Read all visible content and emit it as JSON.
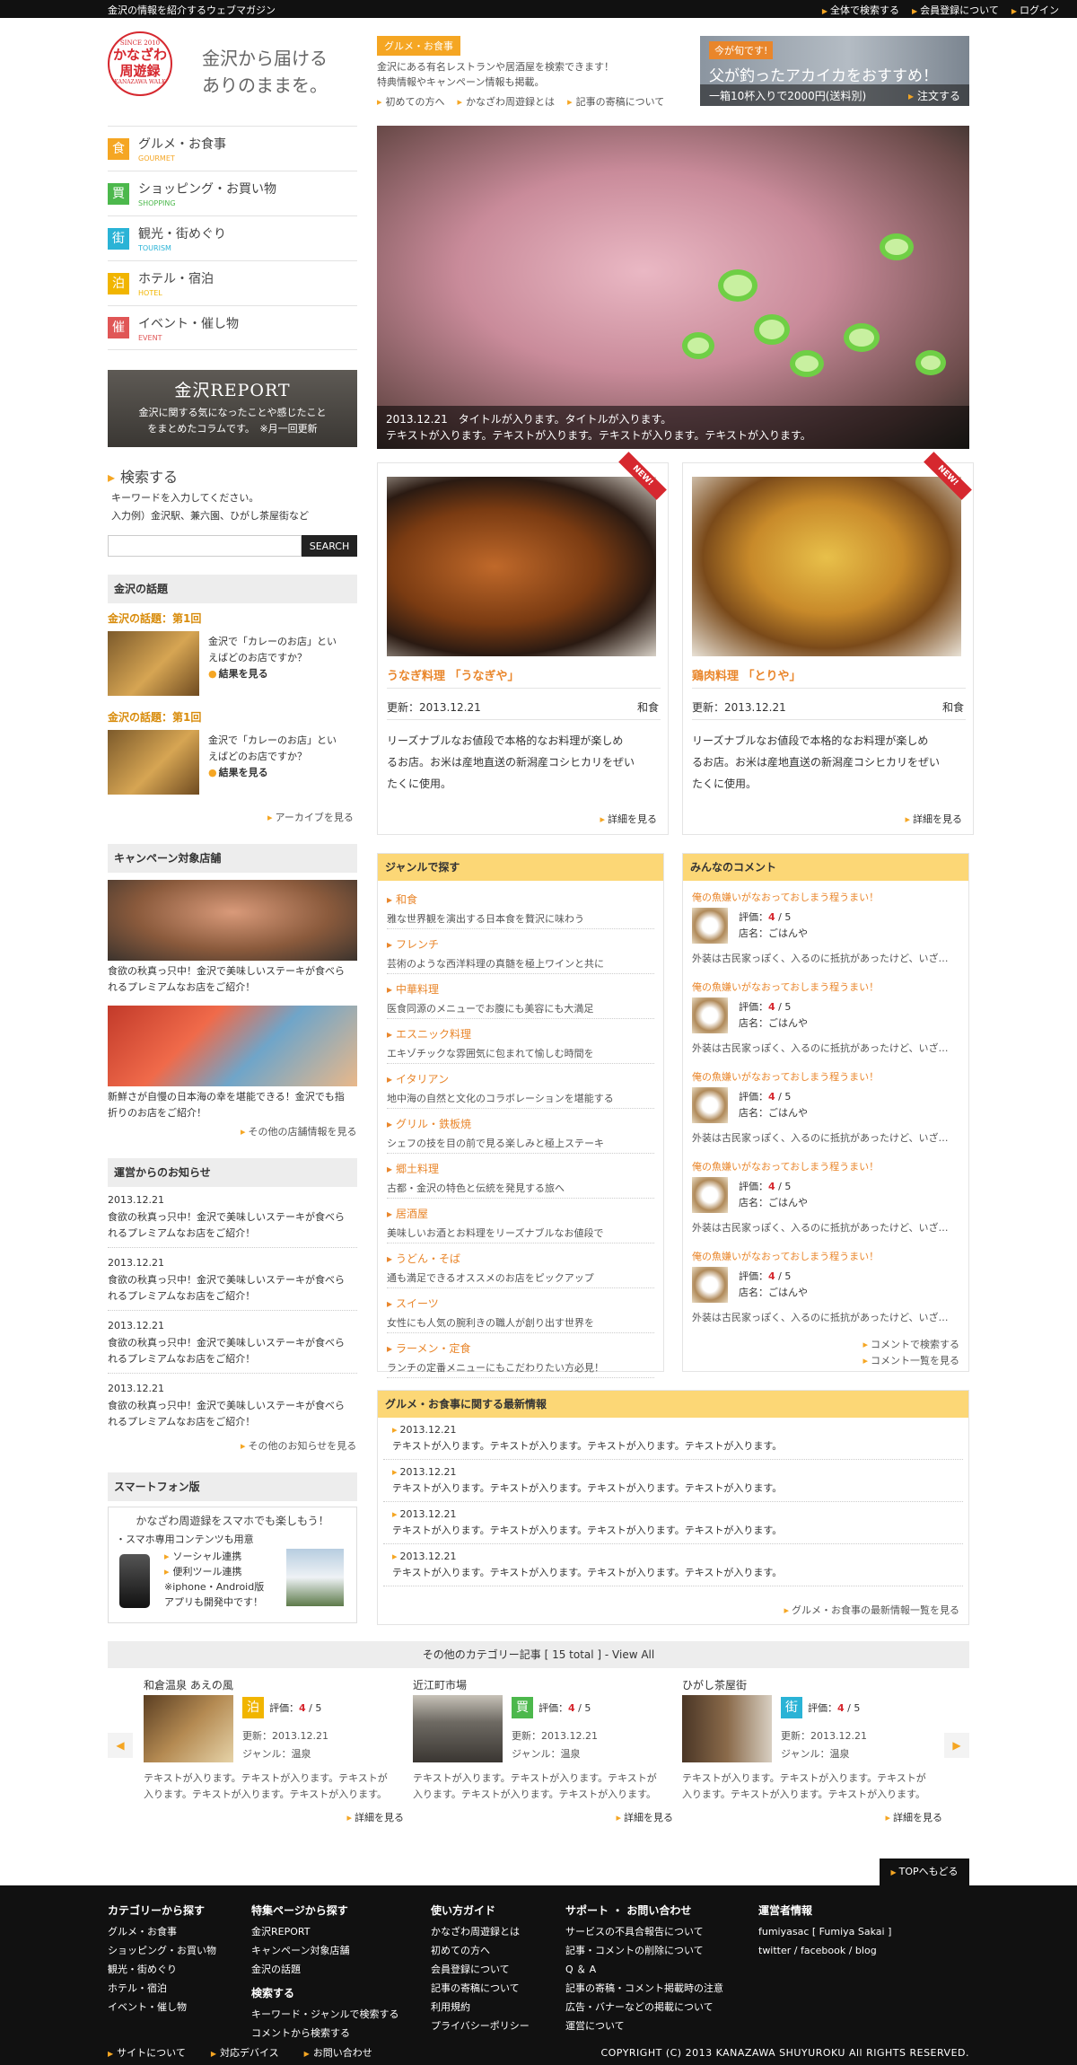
{
  "topbar": {
    "tagline": "金沢の情報を紹介するウェブマガジン",
    "links": [
      "全体で検索する",
      "会員登録について",
      "ログイン"
    ]
  },
  "logo": {
    "since": "SINCE 2010",
    "line1": "かなざわ",
    "line2": "周遊録",
    "sub": "KANAZAWA WALK"
  },
  "catchcopy": [
    "金沢から届ける",
    "ありのままを。"
  ],
  "header": {
    "category": "グルメ・お食事",
    "intro": [
      "金沢にある有名レストランや居酒屋を検索できます！",
      "特典情報やキャンペーン情報も掲載。"
    ],
    "links": [
      "初めての方へ",
      "かなざわ周遊録とは",
      "記事の寄稿について"
    ]
  },
  "promo": {
    "badge": "今が旬です!",
    "title": "父が釣ったアカイカをおすすめ！",
    "sub": "一箱10杯入りで2000円(送料別)",
    "action": "注文する"
  },
  "nav": [
    {
      "icon": "食",
      "label": "グルメ・お食事",
      "en": "GOURMET",
      "color": "#f5a623"
    },
    {
      "icon": "買",
      "label": "ショッピング・お買い物",
      "en": "SHOPPING",
      "color": "#4cb84c"
    },
    {
      "icon": "街",
      "label": "観光・街めぐり",
      "en": "TOURISM",
      "color": "#2ab3d6"
    },
    {
      "icon": "泊",
      "label": "ホテル・宿泊",
      "en": "HOTEL",
      "color": "#f1b500"
    },
    {
      "icon": "催",
      "label": "イベント・催し物",
      "en": "EVENT",
      "color": "#e05656"
    }
  ],
  "report": {
    "title": "金沢REPORT",
    "desc1": "金沢に関する気になったことや感じたこと",
    "desc2": "をまとめたコラムです。",
    "note": "※月一回更新"
  },
  "search": {
    "title": "検索する",
    "hint": "キーワードを入力してください。",
    "example": "入力例）金沢駅、兼六園、ひがし茶屋街など",
    "placeholder": "",
    "button": "SEARCH"
  },
  "topics": {
    "title": "金沢の話題",
    "items": [
      {
        "rank": "金沢の話題：第1回",
        "q1": "金沢で「カレーのお店」とい",
        "q2": "えばどのお店ですか？",
        "result": "結果を見る"
      },
      {
        "rank": "金沢の話題：第1回",
        "q1": "金沢で「カレーのお店」とい",
        "q2": "えばどのお店ですか？",
        "result": "結果を見る"
      }
    ],
    "archive": "アーカイブを見る"
  },
  "campaign": {
    "title": "キャンペーン対象店舗",
    "items": [
      {
        "l1": "食欲の秋真っ只中！金沢で美味しいステーキが食べら",
        "l2": "れるプレミアムなお店をご紹介！"
      },
      {
        "l1": "新鮮さが自慢の日本海の幸を堪能できる！金沢でも指",
        "l2": "折りのお店をご紹介！"
      }
    ],
    "more": "その他の店舗情報を見る"
  },
  "notice": {
    "title": "運営からのお知らせ",
    "items": [
      {
        "date": "2013.12.21",
        "l1": "食欲の秋真っ只中！金沢で美味しいステーキが食べら",
        "l2": "れるプレミアムなお店をご紹介！"
      },
      {
        "date": "2013.12.21",
        "l1": "食欲の秋真っ只中！金沢で美味しいステーキが食べら",
        "l2": "れるプレミアムなお店をご紹介！"
      },
      {
        "date": "2013.12.21",
        "l1": "食欲の秋真っ只中！金沢で美味しいステーキが食べら",
        "l2": "れるプレミアムなお店をご紹介！"
      },
      {
        "date": "2013.12.21",
        "l1": "食欲の秋真っ只中！金沢で美味しいステーキが食べら",
        "l2": "れるプレミアムなお店をご紹介！"
      }
    ],
    "more": "その他のお知らせを見る"
  },
  "smartphone": {
    "title": "スマートフォン版",
    "lead": "かなざわ周遊録をスマホでも楽しもう！",
    "l1": "・スマホ専用コンテンツも用意",
    "l2": "ソーシャル連携",
    "l3": "便利ツール連携",
    "l4": "※iphone・Android版",
    "l5": "アプリも開発中です！"
  },
  "hero": {
    "caption1": "2013.12.21　タイトルが入ります。タイトルが入ります。",
    "caption2": "テキストが入ります。テキストが入ります。テキストが入ります。テキストが入ります。"
  },
  "cards": [
    {
      "badge": "NEW!",
      "title": "うなぎ料理 「うなぎや」",
      "updated": "更新：2013.12.21",
      "genre": "和食",
      "d1": "リーズナブルなお値段で本格的なお料理が楽しめ",
      "d2": "るお店。お米は産地直送の新潟産コシヒカリをぜい",
      "d3": "たくに使用。",
      "more": "詳細を見る"
    },
    {
      "badge": "NEW!",
      "title": "鶏肉料理 「とりや」",
      "updated": "更新：2013.12.21",
      "genre": "和食",
      "d1": "リーズナブルなお値段で本格的なお料理が楽しめ",
      "d2": "るお店。お米は産地直送の新潟産コシヒカリをぜい",
      "d3": "たくに使用。",
      "more": "詳細を見る"
    }
  ],
  "genre": {
    "title": "ジャンルで探す",
    "items": [
      {
        "name": "和食",
        "desc": "雅な世界観を演出する日本食を贅沢に味わう"
      },
      {
        "name": "フレンチ",
        "desc": "芸術のような西洋料理の真髄を極上ワインと共に"
      },
      {
        "name": "中華料理",
        "desc": "医食同源のメニューでお腹にも美容にも大満足"
      },
      {
        "name": "エスニック料理",
        "desc": "エキゾチックな雰囲気に包まれて愉しむ時間を"
      },
      {
        "name": "イタリアン",
        "desc": "地中海の自然と文化のコラボレーションを堪能する"
      },
      {
        "name": "グリル・鉄板焼",
        "desc": "シェフの技を目の前で見る楽しみと極上ステーキ"
      },
      {
        "name": "郷土料理",
        "desc": "古都・金沢の特色と伝統を発見する旅へ"
      },
      {
        "name": "居酒屋",
        "desc": "美味しいお酒とお料理をリーズナブルなお値段で"
      },
      {
        "name": "うどん・そば",
        "desc": "通も満足できるオススメのお店をピックアップ"
      },
      {
        "name": "スイーツ",
        "desc": "女性にも人気の腕利きの職人が創り出す世界を"
      },
      {
        "name": "ラーメン・定食",
        "desc": "ランチの定番メニューにもこだわりたい方必見！"
      }
    ]
  },
  "comments": {
    "title": "みんなのコメント",
    "items": [
      {
        "title": "俺の魚嫌いがなおっておしまう程うまい！",
        "rating": "4",
        "max": "5",
        "rating_label": "評価：",
        "shop": "店名：ごはんや",
        "excerpt": "外装は古民家っぽく、入るのに抵抗があったけど、いざ…"
      },
      {
        "title": "俺の魚嫌いがなおっておしまう程うまい！",
        "rating": "4",
        "max": "5",
        "rating_label": "評価：",
        "shop": "店名：ごはんや",
        "excerpt": "外装は古民家っぽく、入るのに抵抗があったけど、いざ…"
      },
      {
        "title": "俺の魚嫌いがなおっておしまう程うまい！",
        "rating": "4",
        "max": "5",
        "rating_label": "評価：",
        "shop": "店名：ごはんや",
        "excerpt": "外装は古民家っぽく、入るのに抵抗があったけど、いざ…"
      },
      {
        "title": "俺の魚嫌いがなおっておしまう程うまい！",
        "rating": "4",
        "max": "5",
        "rating_label": "評価：",
        "shop": "店名：ごはんや",
        "excerpt": "外装は古民家っぽく、入るのに抵抗があったけど、いざ…"
      },
      {
        "title": "俺の魚嫌いがなおっておしまう程うまい！",
        "rating": "4",
        "max": "5",
        "rating_label": "評価：",
        "shop": "店名：ごはんや",
        "excerpt": "外装は古民家っぽく、入るのに抵抗があったけど、いざ…"
      }
    ],
    "search": "コメントで検索する",
    "list": "コメント一覧を見る"
  },
  "latest": {
    "title": "グルメ・お食事に関する最新情報",
    "items": [
      {
        "date": "2013.12.21",
        "text": "テキストが入ります。テキストが入ります。テキストが入ります。テキストが入ります。"
      },
      {
        "date": "2013.12.21",
        "text": "テキストが入ります。テキストが入ります。テキストが入ります。テキストが入ります。"
      },
      {
        "date": "2013.12.21",
        "text": "テキストが入ります。テキストが入ります。テキストが入ります。テキストが入ります。"
      },
      {
        "date": "2013.12.21",
        "text": "テキストが入ります。テキストが入ります。テキストが入ります。テキストが入ります。"
      }
    ],
    "more": "グルメ・お食事の最新情報一覧を見る"
  },
  "other": {
    "title": "その他のカテゴリー記事 [ 15 total ] - View All",
    "items": [
      {
        "title": "和倉温泉 あえの風",
        "icon": "泊",
        "color": "#f1b500",
        "rating_label": "評価：",
        "rating": "4",
        "max": "5",
        "updated": "更新：2013.12.21",
        "genre": "ジャンル：温泉",
        "d1": "テキストが入ります。テキストが入ります。テキストが",
        "d2": "入ります。テキストが入ります。テキストが入ります。",
        "more": "詳細を見る"
      },
      {
        "title": "近江町市場",
        "icon": "買",
        "color": "#4cb84c",
        "rating_label": "評価：",
        "rating": "4",
        "max": "5",
        "updated": "更新：2013.12.21",
        "genre": "ジャンル：温泉",
        "d1": "テキストが入ります。テキストが入ります。テキストが",
        "d2": "入ります。テキストが入ります。テキストが入ります。",
        "more": "詳細を見る"
      },
      {
        "title": "ひがし茶屋街",
        "icon": "街",
        "color": "#2ab3d6",
        "rating_label": "評価：",
        "rating": "4",
        "max": "5",
        "updated": "更新：2013.12.21",
        "genre": "ジャンル：温泉",
        "d1": "テキストが入ります。テキストが入ります。テキストが",
        "d2": "入ります。テキストが入ります。テキストが入ります。",
        "more": "詳細を見る"
      }
    ]
  },
  "totop": "TOPへもどる",
  "footer": {
    "c1": {
      "title": "カテゴリーから探す",
      "items": [
        "グルメ・お食事",
        "ショッピング・お買い物",
        "観光・街めぐり",
        "ホテル・宿泊",
        "イベント・催し物"
      ]
    },
    "c2": {
      "title": "特集ページから探す",
      "items": [
        "金沢REPORT",
        "キャンペーン対象店舗",
        "金沢の話題"
      ],
      "title2": "検索する",
      "items2": [
        "キーワード・ジャンルで検索する",
        "コメントから検索する"
      ]
    },
    "c3": {
      "title": "使い方ガイド",
      "items": [
        "かなざわ周遊録とは",
        "初めての方へ",
        "会員登録について",
        "記事の寄稿について",
        "利用規約",
        "プライバシーポリシー"
      ]
    },
    "c4": {
      "title": "サポート ・ お問い合わせ",
      "items": [
        "サービスの不具合報告について",
        "記事・コメントの削除について",
        "Q ＆ A",
        "記事の寄稿・コメント掲載時の注意",
        "広告・バナーなどの掲載について",
        "運営について"
      ]
    },
    "c5": {
      "title": "運営者情報",
      "items": [
        "fumiyasac [ Fumiya Sakai ]",
        "twitter / facebook / blog"
      ]
    },
    "bottom": [
      "サイトについて",
      "対応デバイス",
      "お問い合わせ"
    ],
    "copyright": "COPYRIGHT (C) 2013 KANAZAWA SHUYUROKU All RIGHTS RESERVED."
  }
}
